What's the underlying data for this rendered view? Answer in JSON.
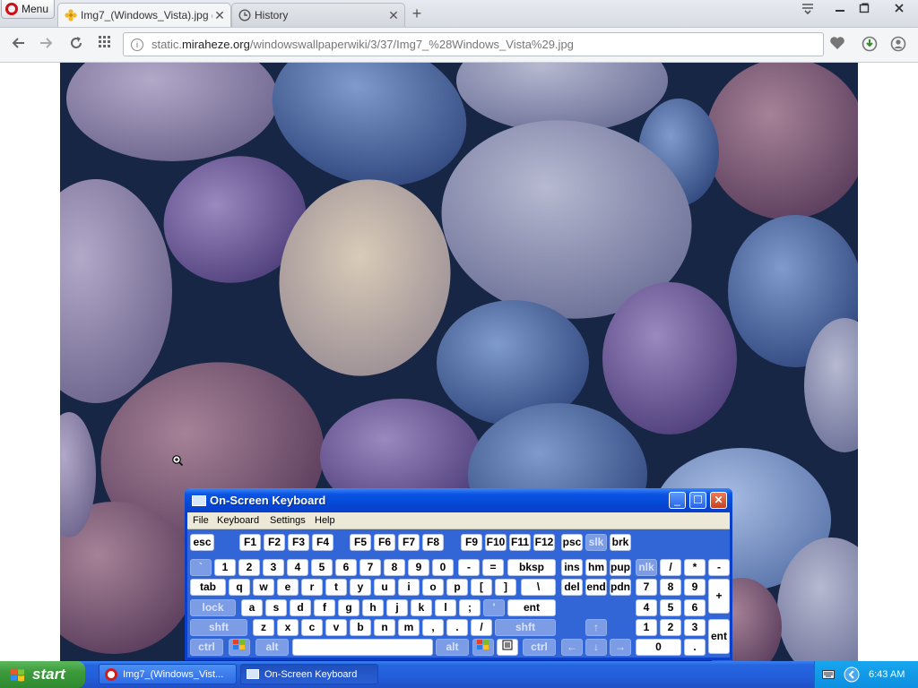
{
  "browser": {
    "menu_label": "Menu",
    "tabs": [
      {
        "label": "Img7_(Windows_Vista).jpg (",
        "icon": "flower-icon"
      },
      {
        "label": "History",
        "icon": "clock-icon"
      }
    ],
    "url": {
      "prefix": "static.",
      "domain": "miraheze.org",
      "path": "/windowswallpaperwiki/3/37/Img7_%28Windows_Vista%29.jpg"
    }
  },
  "osk": {
    "title": "On-Screen Keyboard",
    "menu": [
      "File",
      "Keyboard",
      "Settings",
      "Help"
    ],
    "keys": {
      "esc": "esc",
      "fn": [
        "F1",
        "F2",
        "F3",
        "F4",
        "F5",
        "F6",
        "F7",
        "F8",
        "F9",
        "F10",
        "F11",
        "F12"
      ],
      "psc": "psc",
      "slk": "slk",
      "brk": "brk",
      "row1": [
        "`",
        "1",
        "2",
        "3",
        "4",
        "5",
        "6",
        "7",
        "8",
        "9",
        "0",
        "-",
        "="
      ],
      "bksp": "bksp",
      "ins": "ins",
      "hm": "hm",
      "pup": "pup",
      "nlk": "nlk",
      "num_slash": "/",
      "num_star": "*",
      "num_minus": "-",
      "tab": "tab",
      "row2": [
        "q",
        "w",
        "e",
        "r",
        "t",
        "y",
        "u",
        "i",
        "o",
        "p",
        "[",
        "]",
        "\\"
      ],
      "del": "del",
      "end": "end",
      "pdn": "pdn",
      "num_row2": [
        "7",
        "8",
        "9"
      ],
      "num_plus": "+",
      "lock": "lock",
      "row3": [
        "a",
        "s",
        "d",
        "f",
        "g",
        "h",
        "j",
        "k",
        "l",
        ";",
        "'"
      ],
      "ent": "ent",
      "num_row3": [
        "4",
        "5",
        "6"
      ],
      "shft": "shft",
      "row4": [
        "z",
        "x",
        "c",
        "v",
        "b",
        "n",
        "m",
        ",",
        ".",
        "/"
      ],
      "num_row4": [
        "1",
        "2",
        "3"
      ],
      "ctrl": "ctrl",
      "alt": "alt",
      "num_zero": "0",
      "num_dot": ".",
      "num_ent": "ent"
    }
  },
  "taskbar": {
    "start": "start",
    "tasks": [
      "Img7_(Windows_Vist...",
      "On-Screen Keyboard"
    ],
    "clock": "6:43 AM"
  }
}
